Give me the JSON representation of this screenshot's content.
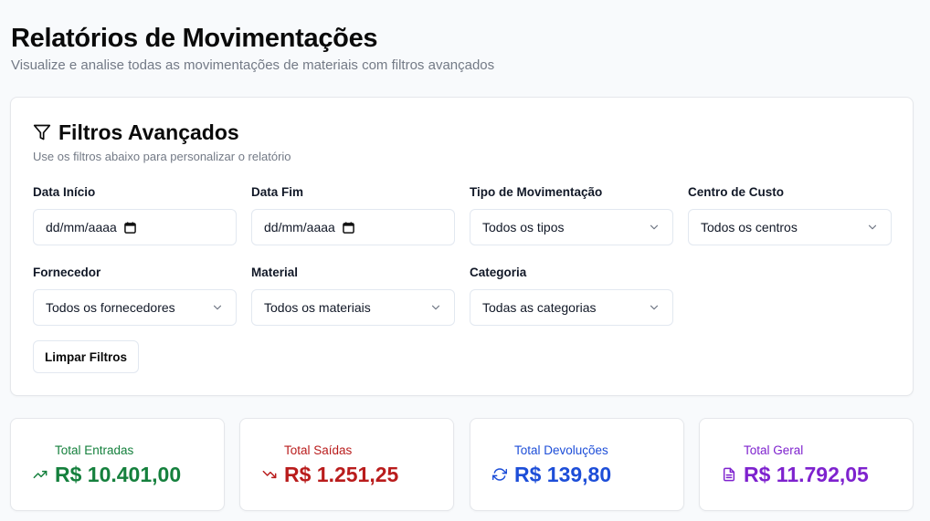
{
  "header": {
    "title": "Relatórios de Movimentações",
    "subtitle": "Visualize e analise todas as movimentações de materiais com filtros avançados"
  },
  "filters": {
    "title": "Filtros Avançados",
    "description": "Use os filtros abaixo para personalizar o relatório",
    "icon": "filter-icon",
    "fields": {
      "data_inicio": {
        "label": "Data Início",
        "placeholder": "dd/mm/aaaa"
      },
      "data_fim": {
        "label": "Data Fim",
        "placeholder": "dd/mm/aaaa"
      },
      "tipo": {
        "label": "Tipo de Movimentação",
        "value": "Todos os tipos"
      },
      "centro": {
        "label": "Centro de Custo",
        "value": "Todos os centros"
      },
      "fornecedor": {
        "label": "Fornecedor",
        "value": "Todos os fornecedores"
      },
      "material": {
        "label": "Material",
        "value": "Todos os materiais"
      },
      "categoria": {
        "label": "Categoria",
        "value": "Todas as categorias"
      }
    },
    "clear_label": "Limpar Filtros"
  },
  "stats": [
    {
      "label": "Total Entradas",
      "value": "R$ 10.401,00",
      "color": "#15803d",
      "icon": "trending-up-icon"
    },
    {
      "label": "Total Saídas",
      "value": "R$ 1.251,25",
      "color": "#b91c1c",
      "icon": "trending-down-icon"
    },
    {
      "label": "Total Devoluções",
      "value": "R$ 139,80",
      "color": "#1d4ed8",
      "icon": "refresh-icon"
    },
    {
      "label": "Total Geral",
      "value": "R$ 11.792,05",
      "color": "#7e22ce",
      "icon": "file-text-icon"
    }
  ]
}
